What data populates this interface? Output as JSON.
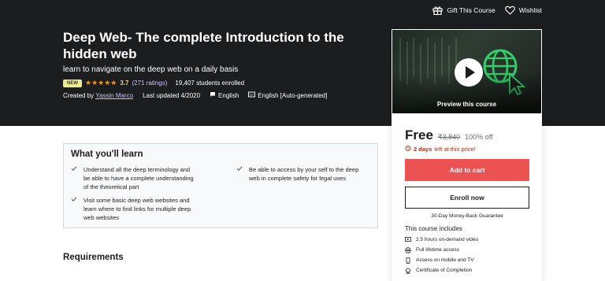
{
  "topbar": {
    "gift_label": "Gift This Course",
    "wishlist_label": "Wishlist",
    "gift_icon": "gift-icon",
    "wishlist_icon": "heart-icon"
  },
  "course": {
    "title": "Deep Web- The complete Introduction to the hidden web",
    "subtitle": "learn to navigate on the deep web on a daily basis",
    "badge": "NEW",
    "rating_value": "3.7",
    "rating_count": "(271 ratings)",
    "rating_stars": 3.7,
    "students": "19,407 students enrolled",
    "created_by_prefix": "Created by",
    "author": "Yassin Marco",
    "last_updated": "Last updated 4/2020",
    "language": "English",
    "captions": "English [Auto-generated]"
  },
  "sidebar_card": {
    "preview_label": "Preview this course",
    "price": "Free",
    "old_price": "₹3,840",
    "discount": "100% off",
    "timer_bold": "2 days",
    "timer_rest": "left at this price!",
    "add_to_cart": "Add to cart",
    "enroll_now": "Enroll now",
    "guarantee": "30-Day Money-Back Guarantee",
    "includes_title": "This course includes",
    "includes": [
      {
        "icon": "video-icon",
        "label": "2.5 hours on-demand video"
      },
      {
        "icon": "infinity-icon",
        "label": "Full lifetime access"
      },
      {
        "icon": "mobile-icon",
        "label": "Access on mobile and TV"
      },
      {
        "icon": "certificate-icon",
        "label": "Certificate of Completion"
      }
    ]
  },
  "learn": {
    "title": "What you'll learn",
    "items": [
      "Understand all the deep terminology and be able to have a complete understanding of the theoretical part",
      "Be able to access by your self to the deep web in complete safety for legal uses",
      "Visit some basic deep web websites and learn where to find links for multiple deep web websites"
    ]
  },
  "requirements": {
    "title": "Requirements"
  },
  "colors": {
    "hero_bg": "#1c1d1f",
    "accent_purple": "#cec0fc",
    "star_orange": "#e59819",
    "cart_red": "#ec5252",
    "badge_yellow": "#eceb98"
  }
}
